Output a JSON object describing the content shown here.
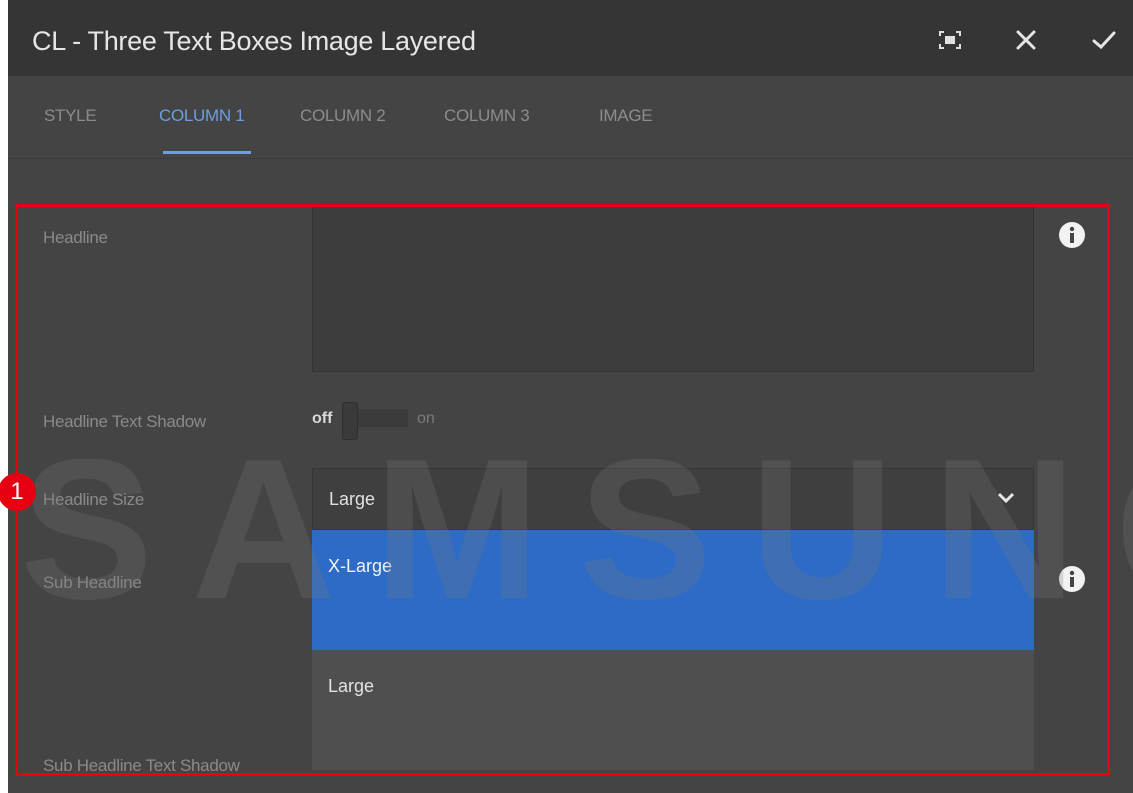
{
  "dialog": {
    "title": "CL - Three Text Boxes Image Layered",
    "fullscreen_icon": "fullscreen-icon",
    "close_icon": "close-icon",
    "confirm_icon": "checkmark-icon"
  },
  "tabs": [
    {
      "label": "STYLE"
    },
    {
      "label": "COLUMN 1",
      "active": true
    },
    {
      "label": "COLUMN 2"
    },
    {
      "label": "COLUMN 3"
    },
    {
      "label": "IMAGE"
    }
  ],
  "form": {
    "headline_label": "Headline",
    "headline_value": "",
    "headline_shadow_label": "Headline Text Shadow",
    "toggle_off": "off",
    "toggle_on": "on",
    "headline_size_label": "Headline Size",
    "headline_size_value": "Large",
    "sub_headline_label": "Sub Headline",
    "sub_headline_shadow_label": "Sub Headline Text Shadow"
  },
  "dropdown": {
    "options": [
      {
        "label": "X-Large",
        "highlighted": true
      },
      {
        "label": "Large"
      }
    ]
  },
  "annotation": {
    "badge": "1",
    "highlight_color": "#e60012"
  },
  "watermark": "SAMSUNG",
  "colors": {
    "accent": "#6c9ee0",
    "selected_option": "#2e6bc6"
  }
}
